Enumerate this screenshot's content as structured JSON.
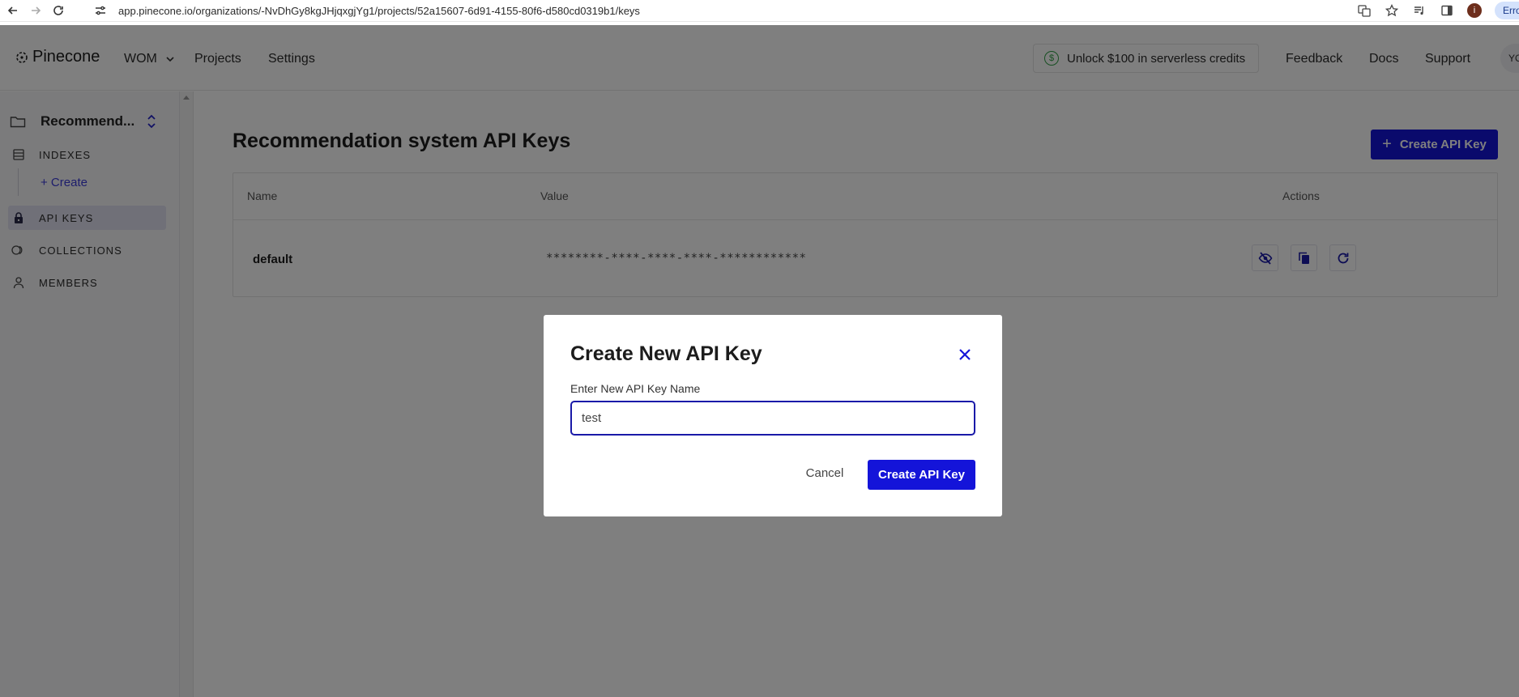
{
  "browser": {
    "url": "app.pinecone.io/organizations/-NvDhGy8kgJHjqxgjYg1/projects/52a15607-6d91-4155-80f6-d580cd0319b1/keys",
    "profile_initial": "i",
    "error_label": "Erro"
  },
  "header": {
    "logo_text": "Pinecone",
    "org": "WOM",
    "nav": {
      "projects": "Projects",
      "settings": "Settings"
    },
    "credits": "Unlock $100 in serverless credits",
    "credits_symbol": "$",
    "links": {
      "feedback": "Feedback",
      "docs": "Docs",
      "support": "Support"
    },
    "avatar_initials": "YO"
  },
  "sidebar": {
    "project_name": "Recommend...",
    "indexes": "INDEXES",
    "create_link": "+ Create",
    "api_keys": "API KEYS",
    "collections": "COLLECTIONS",
    "members": "MEMBERS"
  },
  "main": {
    "title": "Recommendation system API Keys",
    "create_button": "Create API Key",
    "create_plus": "+",
    "table": {
      "headers": {
        "name": "Name",
        "value": "Value",
        "actions": "Actions"
      },
      "rows": [
        {
          "name": "default",
          "value": "********-****-****-****-************"
        }
      ]
    }
  },
  "dialog": {
    "title": "Create New API Key",
    "label": "Enter New API Key Name",
    "input_value": "test",
    "cancel": "Cancel",
    "create": "Create API Key"
  },
  "colors": {
    "primary": "#1414d9",
    "overlay": "rgba(0,0,0,0.5)",
    "credit_green": "#2f9e44"
  }
}
